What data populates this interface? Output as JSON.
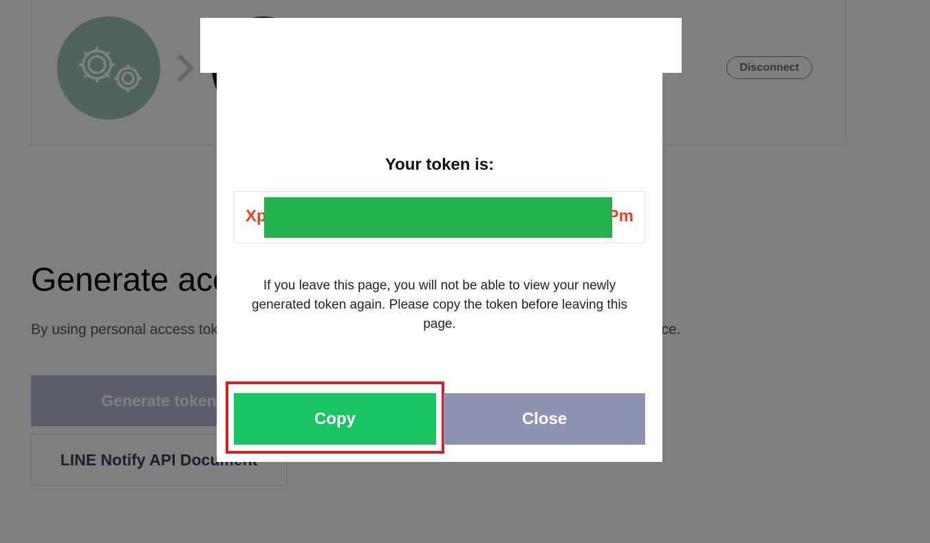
{
  "background": {
    "connection_card": {
      "disconnect_label": "Disconnect"
    },
    "section_title": "Generate access token (For developers)",
    "section_description": "By using personal access tokens, you can configure notifications without having to add a web service.",
    "generate_token_label": "Generate token",
    "api_doc_label": "LINE Notify API Document"
  },
  "modal": {
    "title": "Your token is:",
    "token_prefix": "Xp",
    "token_suffix": "Pm",
    "message": "If you leave this page, you will not be able to view your newly generated token again. Please copy the token before leaving this page.",
    "copy_label": "Copy",
    "close_label": "Close"
  },
  "colors": {
    "copy_button": "#19c462",
    "close_button": "#9094b3",
    "token_text": "#e8431d",
    "highlight": "#e11b22",
    "redaction": "#23b14d"
  }
}
